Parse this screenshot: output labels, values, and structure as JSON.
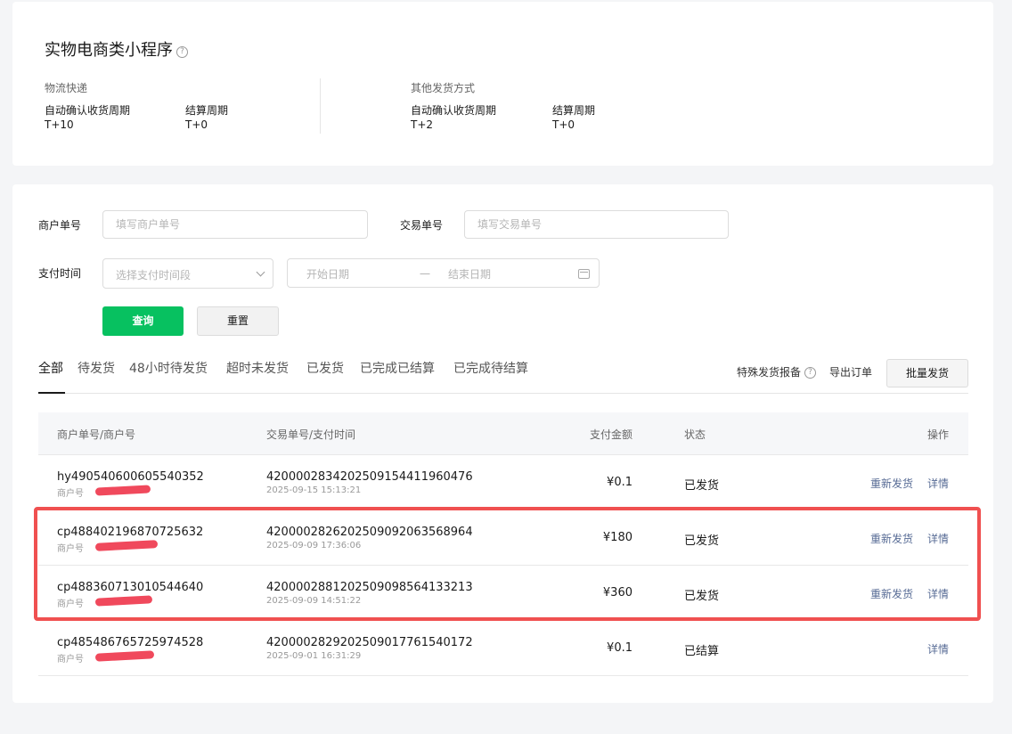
{
  "summary": {
    "title": "实物电商类小程序",
    "help_glyph": "?",
    "logistics": {
      "label": "物流快递",
      "confirm_key": "自动确认收货周期",
      "confirm_val": "T+10",
      "settle_key": "结算周期",
      "settle_val": "T+0"
    },
    "other": {
      "label": "其他发货方式",
      "confirm_key": "自动确认收货周期",
      "confirm_val": "T+2",
      "settle_key": "结算周期",
      "settle_val": "T+0"
    }
  },
  "filters": {
    "merchant_no_label": "商户单号",
    "merchant_no_placeholder": "填写商户单号",
    "trade_no_label": "交易单号",
    "trade_no_placeholder": "填写交易单号",
    "pay_time_label": "支付时间",
    "pay_time_placeholder": "选择支付时间段",
    "start_date_placeholder": "开始日期",
    "date_sep": "一",
    "end_date_placeholder": "结束日期",
    "search_label": "查询",
    "reset_label": "重置"
  },
  "tabs": [
    {
      "label": "全部",
      "active": true
    },
    {
      "label": "待发货"
    },
    {
      "label": "48小时待发货"
    },
    {
      "label": "超时未发货"
    },
    {
      "label": "已发货"
    },
    {
      "label": "已完成已结算"
    },
    {
      "label": "已完成待结算"
    }
  ],
  "actions": {
    "special_report": "特殊发货报备",
    "export": "导出订单",
    "batch_ship": "批量发货"
  },
  "table": {
    "headers": {
      "merchant": "商户单号/商户号",
      "trade": "交易单号/支付时间",
      "amount": "支付金额",
      "status": "状态",
      "op": "操作"
    },
    "rows": [
      {
        "merchant_no": "hy490540600605540352",
        "merchant_id_label": "商户号",
        "trade_no": "4200002834202509154411960476",
        "pay_time": "2025-09-15 15:13:21",
        "amount": "¥0.1",
        "status": "已发货",
        "reship": "重新发货",
        "detail": "详情"
      },
      {
        "merchant_no": "cp488402196870725632",
        "merchant_id_label": "商户号",
        "trade_no": "4200002826202509092063568964",
        "pay_time": "2025-09-09 17:36:06",
        "amount": "¥180",
        "status": "已发货",
        "reship": "重新发货",
        "detail": "详情"
      },
      {
        "merchant_no": "cp488360713010544640",
        "merchant_id_label": "商户号",
        "trade_no": "4200002881202509098564133213",
        "pay_time": "2025-09-09 14:51:22",
        "amount": "¥360",
        "status": "已发货",
        "reship": "重新发货",
        "detail": "详情"
      },
      {
        "merchant_no": "cp485486765725974528",
        "merchant_id_label": "商户号",
        "trade_no": "4200002829202509017761540172",
        "pay_time": "2025-09-01 16:31:29",
        "amount": "¥0.1",
        "status": "已结算",
        "reship": null,
        "detail": "详情"
      }
    ]
  },
  "colors": {
    "primary": "#07c160",
    "link": "#576b95",
    "highlight": "#f05050",
    "redaction": "#f0495c"
  }
}
